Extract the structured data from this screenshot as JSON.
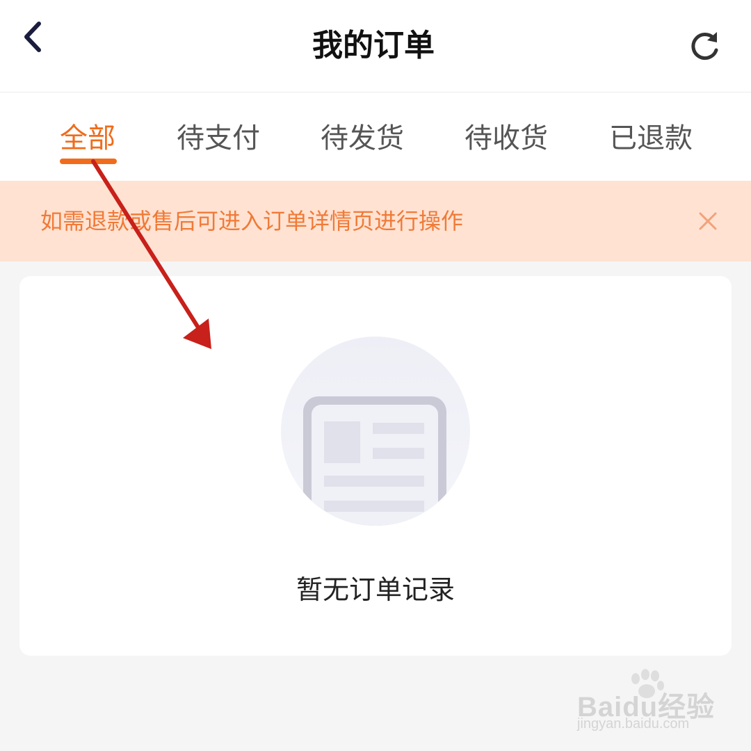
{
  "header": {
    "title": "我的订单",
    "back_icon": "chevron-left-icon",
    "refresh_icon": "refresh-icon"
  },
  "tabs": [
    {
      "label": "全部",
      "active": true
    },
    {
      "label": "待支付",
      "active": false
    },
    {
      "label": "待发货",
      "active": false
    },
    {
      "label": "待收货",
      "active": false
    },
    {
      "label": "已退款",
      "active": false
    }
  ],
  "notice": {
    "text": "如需退款或售后可进入订单详情页进行操作",
    "close_icon": "close-icon"
  },
  "empty_state": {
    "illustration": "empty-orders-illustration",
    "text": "暂无订单记录"
  },
  "watermark": {
    "brand": "Baidu经验",
    "url": "jingyan.baidu.com"
  },
  "colors": {
    "accent": "#f06c1c",
    "notice_background": "#ffe2d2",
    "notice_text": "#f07a37",
    "annotation_arrow": "#c8201a"
  }
}
